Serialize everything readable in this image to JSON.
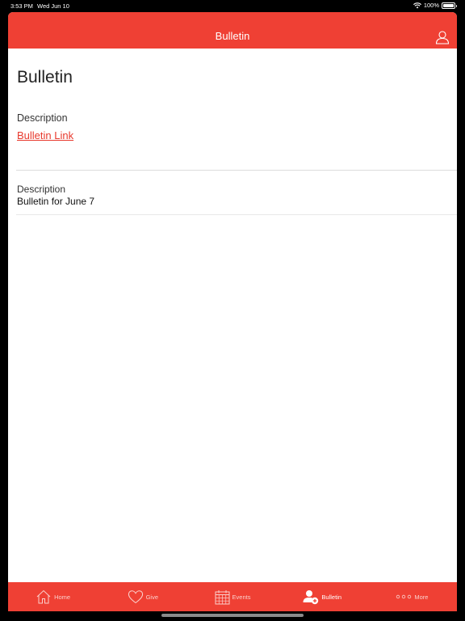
{
  "status": {
    "time": "3:53 PM",
    "date": "Wed Jun 10",
    "battery": "100%"
  },
  "nav": {
    "title": "Bulletin",
    "profile_icon": "person-outline-icon"
  },
  "page": {
    "title": "Bulletin",
    "section1": {
      "label": "Description",
      "link_text": "Bulletin Link"
    },
    "section2": {
      "label": "Description",
      "value": "Bulletin for June 7"
    }
  },
  "tabs": [
    {
      "label": "Home",
      "icon": "home-icon"
    },
    {
      "label": "Give",
      "icon": "heart-icon"
    },
    {
      "label": "Events",
      "icon": "calendar-icon"
    },
    {
      "label": "Bulletin",
      "icon": "add-person-icon",
      "active": true
    },
    {
      "label": "More",
      "icon": "more-dots-icon"
    }
  ],
  "colors": {
    "accent": "#ef4034",
    "link": "#e8392d"
  }
}
